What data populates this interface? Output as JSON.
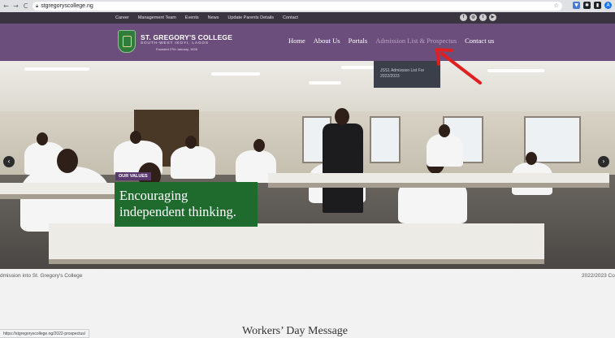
{
  "browser": {
    "url": "stgregoryscollege.ng",
    "back": "←",
    "forward": "→",
    "reload": "C"
  },
  "topbar": {
    "links": [
      "Career",
      "Management Team",
      "Events",
      "News",
      "Update Parents Details",
      "Contact"
    ],
    "social_icons": [
      "facebook-icon",
      "instagram-icon",
      "twitter-icon",
      "youtube-icon"
    ]
  },
  "brand": {
    "name": "ST. GREGORY'S COLLEGE",
    "subtitle": "SOUTH-WEST IKOYI, LAGOS",
    "founded": "Founded 27th January, 1928"
  },
  "nav": {
    "items": [
      "Home",
      "About Us",
      "Portals",
      "Admission List & Prospectus",
      "Contact us"
    ],
    "active_index": 3
  },
  "dropdown": {
    "item": "JSS1 Admission List For 2022/2023"
  },
  "hero": {
    "values_tag": "OUR VALUES",
    "line1": "Encouraging",
    "line2": "independent thinking.",
    "prev_arrow": "‹",
    "next_arrow": "›"
  },
  "ticker": {
    "left": "dmission into St. Gregory's College",
    "right": "2022/2023 Co"
  },
  "section": {
    "title": "Workers’ Day Message"
  },
  "status_bar": {
    "url": "https://stgregoryscollege.ng/2022-prospectus/"
  },
  "colors": {
    "header": "#6b4e7c",
    "topbar": "#3a3440",
    "values_box": "#1f6b2e",
    "dropdown": "#3b3f4a",
    "annotation_arrow": "#e02020"
  }
}
